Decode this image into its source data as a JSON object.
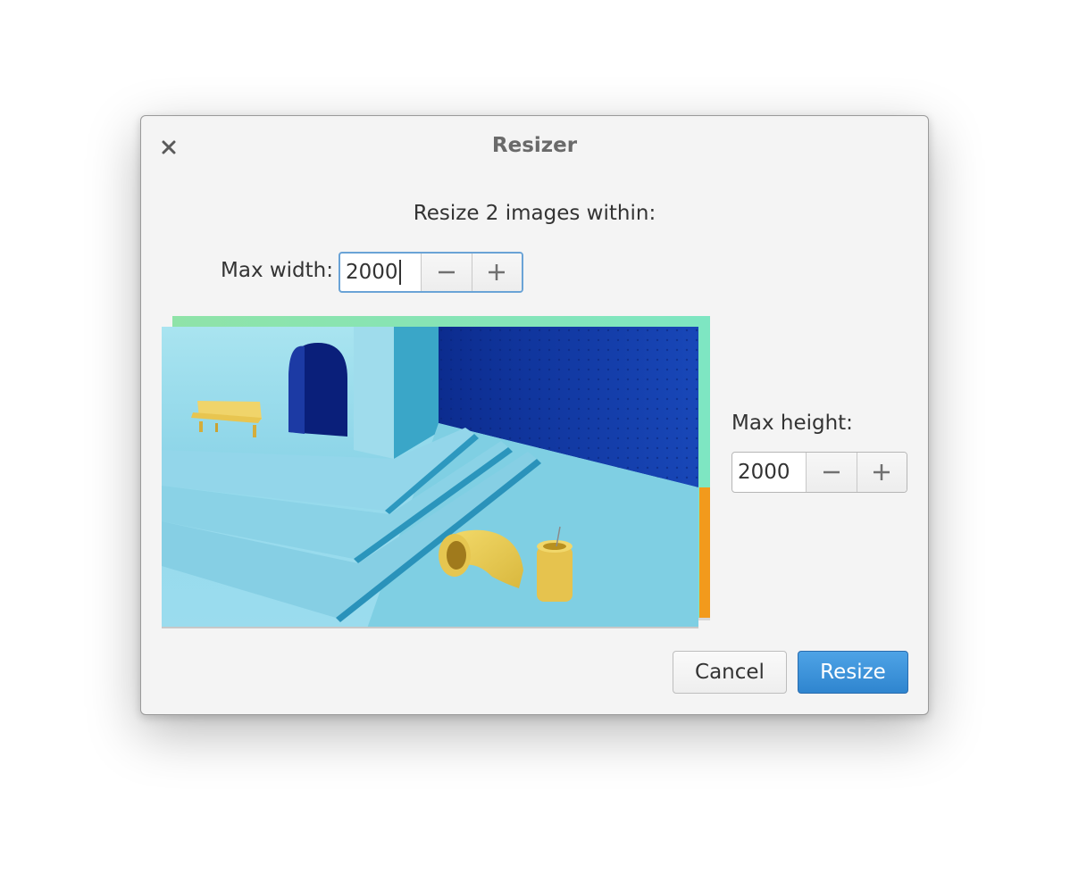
{
  "dialog": {
    "title": "Resizer",
    "subtitle": "Resize 2 images within:"
  },
  "max_width": {
    "label": "Max width:",
    "value": "2000"
  },
  "max_height": {
    "label": "Max height:",
    "value": "2000"
  },
  "icons": {
    "close": "close-icon",
    "decrement": "minus-icon",
    "increment": "plus-icon"
  },
  "buttons": {
    "cancel": "Cancel",
    "resize": "Resize"
  },
  "colors": {
    "accent": "#3a8fd8",
    "focus_ring": "#6aa3d6"
  }
}
